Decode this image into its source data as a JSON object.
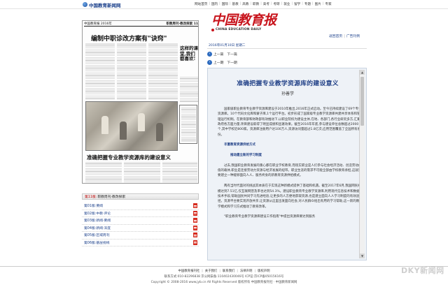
{
  "site": {
    "logo_text": "中国教育新闻网"
  },
  "topnav": [
    "网站首页",
    "国内",
    "国际",
    "基教",
    "高教",
    "职教",
    "高考",
    "考研",
    "就业",
    "留学",
    "专题",
    "图片",
    "专家"
  ],
  "paper": {
    "header_left": "中国教育报 2016年",
    "header_right": "职教周刊·教改探索 11",
    "headline": "编制中职诊改方案有\"诀窍\"",
    "side_title": "这样的课堂,我们都喜欢!",
    "sub_headline": "准确把握专业教学资源库的建设意义"
  },
  "issue_bar": {
    "label": "第11版:",
    "name": "职教周刊·教改探索"
  },
  "pages": [
    {
      "label": "第01版:要闻"
    },
    {
      "label": "第02版:中教·评论"
    },
    {
      "label": "第03版:新闻·要闻"
    },
    {
      "label": "第04版:新闻·深度"
    },
    {
      "label": "第05版:区域周刊"
    },
    {
      "label": "第06版:基层视线"
    }
  ],
  "masthead": {
    "title_cn": "中国教育报",
    "title_en": "CHINA EDUCATION DAILY"
  },
  "links_right": [
    "返回首页",
    "广告刊例"
  ],
  "date_line": "2016年01月10日 星期二",
  "nav_top": {
    "prev": "上一篇",
    "next": "下一篇"
  },
  "nav_bottom": {
    "prev": "上一期",
    "next": "下一期"
  },
  "article": {
    "title": "准确把握专业教学资源库的建设意义",
    "author": "孙善学",
    "body": [
      {
        "type": "p",
        "text": "国家级职业教育专业教学资源库建设于2010年推出,2016年正式启动。至今已持续建设了69个专业资源库。10个代码文化库和蒙子库,1个运行平台。初步形成了国家级专业教学资源库共建共享体系和管理运行机制。在教育部和财政部有效推动下,以职业院校为建设主体,在地、各部门,各行业研究多方,汇聚政府各方面力量,项目建设取得了明显成绩和显著效果。截至2016年年底,参与建设单位总数超过2000个,其中学校近800家。资源库注册用户达100万人,资源访问量超过1.8亿次,应用范围覆盖了全国所有省份。"
      },
      {
        "type": "gap"
      },
      {
        "type": "sub",
        "text": "丰富教育资源供给方式"
      },
      {
        "type": "gap"
      },
      {
        "type": "sub2",
        "text": "推动建立新的学习制度"
      },
      {
        "type": "gap"
      },
      {
        "type": "p",
        "text": "过去,我国职业教育发展的重心都在职业学校教育,而现实职业是人们参与社会经济活动、创造劳动价值的载体,职业是连接劳动力资源与经济发展的纽带。职业生涯的需求不可能全部由学校教育承担,这就需要建立一种能够面向人人、服务终身的新教育资源供给模式。"
      },
      {
        "type": "gap"
      },
      {
        "type": "p",
        "text": "两有当时代面对的挑战其本质在于实现这种新模式提供了基础和机遇。截至2017年6月,我国网民规模达到7.51亿,仅互联网普及率也达到54.3%。建设职业教育专业教学资源库,利用现代信息技术和数据技术手段,帮助国民共同学习先进经验,让更多的人方便地获取资源,也是建立面向人人学习制度的有效途径。资源平台要实现开放共享,让资源从这里出发面向社会,对人民群众给出有用的学习帮助,这一新的教学模式和学习方式推动了教育改革。"
      },
      {
        "type": "gap"
      },
      {
        "type": "p",
        "text": "\"职业教育专业教学资源库建设工作指南\"中提出资源库要达到服务"
      }
    ]
  },
  "footer": {
    "links": [
      "中国教育报刊社",
      "关于我们",
      "联系我们",
      "法律声明",
      "版权声明"
    ],
    "line1": "联系方式:010-82296838 京公网安备:110402430046号 ICP证:京ICP备05015616号",
    "line2": "Copyright © 2008-2016 www.jyb.cn All Rights Reserved 版权所有 中国教育报刊社 · 中国教育新闻网"
  },
  "watermark": "DKY新闻网"
}
